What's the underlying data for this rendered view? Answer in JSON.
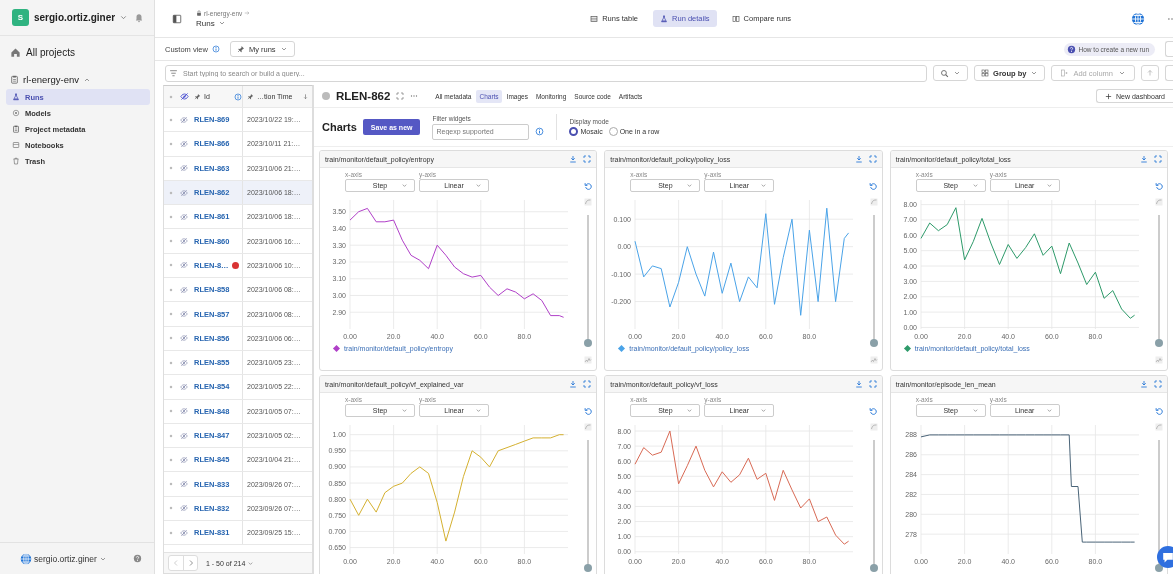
{
  "sidebar": {
    "user": {
      "initial": "S",
      "name": "sergio.ortiz.giner"
    },
    "all_projects": "All projects",
    "project": "rl-energy-env",
    "items": [
      {
        "kind": "runs",
        "label": "Runs",
        "selected": true
      },
      {
        "kind": "models",
        "label": "Models",
        "selected": false
      },
      {
        "kind": "metadata",
        "label": "Project metadata",
        "selected": false
      },
      {
        "kind": "notebooks",
        "label": "Notebooks",
        "selected": false
      },
      {
        "kind": "trash",
        "label": "Trash",
        "selected": false
      }
    ],
    "footer_user": "sergio.ortiz.giner"
  },
  "header": {
    "breadcrumb": "rl-energy-env",
    "page": "Runs",
    "tabs": [
      {
        "kind": "table",
        "label": "Runs table",
        "selected": false
      },
      {
        "kind": "details",
        "label": "Run details",
        "selected": true
      },
      {
        "kind": "compare",
        "label": "Compare runs",
        "selected": false
      }
    ]
  },
  "view_bar": {
    "label": "Custom view",
    "view": "My runs",
    "help_link": "How to create a new run"
  },
  "query_bar": {
    "placeholder": "Start typing to search or build a query...",
    "group_by": "Group by",
    "add_column": {
      "label": "Add column",
      "disabled": true
    }
  },
  "runs_table": {
    "columns": [
      "Id",
      "…tion Time"
    ],
    "rows": [
      {
        "id": "RLEN-869",
        "time": "2023/10/22 19:…",
        "selected": false,
        "failed": false
      },
      {
        "id": "RLEN-866",
        "time": "2023/10/11 21:…",
        "selected": false,
        "failed": false
      },
      {
        "id": "RLEN-863",
        "time": "2023/10/06 21:…",
        "selected": false,
        "failed": false
      },
      {
        "id": "RLEN-862",
        "time": "2023/10/06 18:…",
        "selected": true,
        "failed": false
      },
      {
        "id": "RLEN-861",
        "time": "2023/10/06 18:…",
        "selected": false,
        "failed": false
      },
      {
        "id": "RLEN-860",
        "time": "2023/10/06 16:…",
        "selected": false,
        "failed": false
      },
      {
        "id": "RLEN-8…",
        "time": "2023/10/06 10:…",
        "selected": false,
        "failed": true
      },
      {
        "id": "RLEN-858",
        "time": "2023/10/06 08:…",
        "selected": false,
        "failed": false
      },
      {
        "id": "RLEN-857",
        "time": "2023/10/06 08:…",
        "selected": false,
        "failed": false
      },
      {
        "id": "RLEN-856",
        "time": "2023/10/06 06:…",
        "selected": false,
        "failed": false
      },
      {
        "id": "RLEN-855",
        "time": "2023/10/05 23:…",
        "selected": false,
        "failed": false
      },
      {
        "id": "RLEN-854",
        "time": "2023/10/05 22:…",
        "selected": false,
        "failed": false
      },
      {
        "id": "RLEN-848",
        "time": "2023/10/05 07:…",
        "selected": false,
        "failed": false
      },
      {
        "id": "RLEN-847",
        "time": "2023/10/05 02:…",
        "selected": false,
        "failed": false
      },
      {
        "id": "RLEN-845",
        "time": "2023/10/04 21:…",
        "selected": false,
        "failed": false
      },
      {
        "id": "RLEN-833",
        "time": "2023/09/26 07:…",
        "selected": false,
        "failed": false
      },
      {
        "id": "RLEN-832",
        "time": "2023/09/26 07:…",
        "selected": false,
        "failed": false
      },
      {
        "id": "RLEN-831",
        "time": "2023/09/25 15:…",
        "selected": false,
        "failed": false
      }
    ],
    "pagination": "1 - 50 of 214"
  },
  "run": {
    "id": "RLEN-862",
    "tabs": [
      {
        "label": "All metadata",
        "selected": false
      },
      {
        "label": "Charts",
        "selected": true
      },
      {
        "label": "Images",
        "selected": false
      },
      {
        "label": "Monitoring",
        "selected": false
      },
      {
        "label": "Source code",
        "selected": false
      },
      {
        "label": "Artifacts",
        "selected": false
      }
    ],
    "new_dashboard": "New dashboard"
  },
  "charts_toolbar": {
    "title": "Charts",
    "save": "Save as new",
    "filter_label": "Filter widgets",
    "filter_placeholder": "Regexp supported",
    "display_label": "Display mode",
    "modes": [
      {
        "label": "Mosaic",
        "selected": true
      },
      {
        "label": "One in a row",
        "selected": false
      }
    ]
  },
  "charts": [
    {
      "x_axis": {
        "label": "x-axis",
        "value": "Step"
      },
      "y_axis": {
        "label": "y-axis",
        "value": "Linear"
      },
      "smoothing": {
        "level": 0
      },
      "chart_data": {
        "type": "line",
        "grid": true,
        "title": "train/monitor/default_policy/entropy",
        "x": [
          0,
          4,
          8,
          12,
          16,
          20,
          24,
          28,
          32,
          36,
          40,
          44,
          48,
          52,
          56,
          60,
          64,
          68,
          72,
          76,
          80,
          84,
          88,
          92,
          96,
          98
        ],
        "series": [
          {
            "name": "train/monitor/default_policy/entropy",
            "color": "#b040c8",
            "values": [
              3.45,
              3.5,
              3.52,
              3.44,
              3.44,
              3.45,
              3.33,
              3.24,
              3.21,
              3.16,
              3.3,
              3.24,
              3.17,
              3.13,
              3.11,
              3.12,
              3.05,
              3.0,
              3.04,
              3.02,
              2.98,
              3.01,
              2.97,
              2.88,
              2.88,
              2.87
            ]
          }
        ],
        "xlim": [
          0,
          100
        ],
        "ylim": [
          2.8,
          3.57
        ],
        "xticks": [
          {
            "value": 0,
            "label": "0.00"
          },
          {
            "value": 20,
            "label": "20.0"
          },
          {
            "value": 40,
            "label": "40.0"
          },
          {
            "value": 60,
            "label": "60.0"
          },
          {
            "value": 80,
            "label": "80.0"
          }
        ],
        "yticks": [
          {
            "value": 2.9,
            "label": "2.90"
          },
          {
            "value": 3.0,
            "label": "3.00"
          },
          {
            "value": 3.1,
            "label": "3.10"
          },
          {
            "value": 3.2,
            "label": "3.20"
          },
          {
            "value": 3.3,
            "label": "3.30"
          },
          {
            "value": 3.4,
            "label": "3.40"
          },
          {
            "value": 3.5,
            "label": "3.50"
          }
        ]
      }
    },
    {
      "x_axis": {
        "label": "x-axis",
        "value": "Step"
      },
      "y_axis": {
        "label": "y-axis",
        "value": "Linear"
      },
      "smoothing": {
        "level": 0
      },
      "chart_data": {
        "type": "line",
        "grid": true,
        "title": "train/monitor/default_policy/policy_loss",
        "x": [
          0,
          4,
          8,
          12,
          16,
          20,
          24,
          28,
          32,
          36,
          40,
          44,
          48,
          52,
          56,
          60,
          64,
          68,
          72,
          76,
          80,
          84,
          88,
          92,
          96,
          98
        ],
        "series": [
          {
            "name": "train/monitor/default_policy/policy_loss",
            "color": "#4aa3e8",
            "values": [
              0.02,
              -0.11,
              -0.07,
              -0.08,
              -0.22,
              -0.13,
              0.0,
              -0.1,
              -0.18,
              -0.02,
              -0.17,
              -0.06,
              -0.2,
              -0.11,
              -0.15,
              0.12,
              -0.21,
              -0.04,
              0.1,
              -0.25,
              0.06,
              -0.2,
              0.14,
              -0.2,
              0.03,
              0.05
            ]
          }
        ],
        "xlim": [
          0,
          100
        ],
        "ylim": [
          -0.3,
          0.17
        ],
        "xticks": [
          {
            "value": 0,
            "label": "0.00"
          },
          {
            "value": 20,
            "label": "20.0"
          },
          {
            "value": 40,
            "label": "40.0"
          },
          {
            "value": 60,
            "label": "60.0"
          },
          {
            "value": 80,
            "label": "80.0"
          }
        ],
        "yticks": [
          {
            "value": -0.2,
            "label": "-0.200"
          },
          {
            "value": -0.1,
            "label": "-0.100"
          },
          {
            "value": 0,
            "label": "0.00"
          },
          {
            "value": 0.1,
            "label": "0.100"
          }
        ]
      }
    },
    {
      "x_axis": {
        "label": "x-axis",
        "value": "Step"
      },
      "y_axis": {
        "label": "y-axis",
        "value": "Linear"
      },
      "smoothing": {
        "level": 0
      },
      "chart_data": {
        "type": "line",
        "grid": true,
        "title": "train/monitor/default_policy/total_loss",
        "x": [
          0,
          4,
          8,
          12,
          16,
          20,
          24,
          28,
          32,
          36,
          40,
          44,
          48,
          52,
          56,
          60,
          64,
          68,
          72,
          76,
          80,
          84,
          88,
          92,
          96,
          98
        ],
        "series": [
          {
            "name": "train/monitor/default_policy/total_loss",
            "color": "#2e9a6a",
            "values": [
              5.8,
              6.8,
              6.3,
              6.7,
              7.8,
              4.4,
              5.6,
              7.1,
              5.5,
              4.1,
              5.4,
              4.5,
              5.2,
              6.1,
              4.7,
              5.3,
              3.5,
              5.5,
              4.2,
              2.8,
              3.6,
              1.9,
              2.4,
              1.2,
              0.6,
              0.8
            ]
          }
        ],
        "xlim": [
          0,
          100
        ],
        "ylim": [
          -0.1,
          8.3
        ],
        "xticks": [
          {
            "value": 0,
            "label": "0.00"
          },
          {
            "value": 20,
            "label": "20.0"
          },
          {
            "value": 40,
            "label": "40.0"
          },
          {
            "value": 60,
            "label": "60.0"
          },
          {
            "value": 80,
            "label": "80.0"
          }
        ],
        "yticks": [
          {
            "value": 0,
            "label": "0.00"
          },
          {
            "value": 1,
            "label": "1.00"
          },
          {
            "value": 2,
            "label": "2.00"
          },
          {
            "value": 3,
            "label": "3.00"
          },
          {
            "value": 4,
            "label": "4.00"
          },
          {
            "value": 5,
            "label": "5.00"
          },
          {
            "value": 6,
            "label": "6.00"
          },
          {
            "value": 7,
            "label": "7.00"
          },
          {
            "value": 8,
            "label": "8.00"
          }
        ]
      }
    },
    {
      "x_axis": {
        "label": "x-axis",
        "value": "Step"
      },
      "y_axis": {
        "label": "y-axis",
        "value": "Linear"
      },
      "smoothing": {
        "level": 0
      },
      "chart_data": {
        "type": "line",
        "grid": true,
        "title": "train/monitor/default_policy/vf_explained_var",
        "x": [
          0,
          4,
          8,
          12,
          16,
          20,
          24,
          28,
          32,
          36,
          40,
          44,
          48,
          52,
          56,
          60,
          64,
          68,
          72,
          76,
          80,
          84,
          88,
          92,
          96,
          98
        ],
        "series": [
          {
            "color": "#d4b030",
            "values": [
              0.8,
              0.75,
              0.8,
              0.76,
              0.82,
              0.84,
              0.85,
              0.88,
              0.9,
              0.88,
              0.79,
              0.67,
              0.76,
              0.87,
              0.95,
              0.93,
              0.9,
              0.95,
              0.96,
              0.97,
              0.98,
              0.99,
              0.99,
              0.99,
              1.0,
              1.0
            ]
          }
        ],
        "xlim": [
          0,
          100
        ],
        "ylim": [
          0.63,
          1.03
        ],
        "xticks": [
          {
            "value": 0,
            "label": "0.00"
          },
          {
            "value": 20,
            "label": "20.0"
          },
          {
            "value": 40,
            "label": "40.0"
          },
          {
            "value": 60,
            "label": "60.0"
          },
          {
            "value": 80,
            "label": "80.0"
          }
        ],
        "yticks": [
          {
            "value": 0.65,
            "label": "0.650"
          },
          {
            "value": 0.7,
            "label": "0.700"
          },
          {
            "value": 0.75,
            "label": "0.750"
          },
          {
            "value": 0.8,
            "label": "0.800"
          },
          {
            "value": 0.85,
            "label": "0.850"
          },
          {
            "value": 0.9,
            "label": "0.900"
          },
          {
            "value": 0.95,
            "label": "0.950"
          },
          {
            "value": 1.0,
            "label": "1.00"
          }
        ]
      }
    },
    {
      "x_axis": {
        "label": "x-axis",
        "value": "Step"
      },
      "y_axis": {
        "label": "y-axis",
        "value": "Linear"
      },
      "smoothing": {
        "level": 0
      },
      "chart_data": {
        "type": "line",
        "grid": true,
        "title": "train/monitor/default_policy/vf_loss",
        "x": [
          0,
          4,
          8,
          12,
          16,
          20,
          24,
          28,
          32,
          36,
          40,
          44,
          48,
          52,
          56,
          60,
          64,
          68,
          72,
          76,
          80,
          84,
          88,
          92,
          96,
          98
        ],
        "series": [
          {
            "color": "#d86a55",
            "values": [
              5.8,
              6.9,
              6.4,
              6.6,
              8.0,
              4.5,
              5.7,
              7.0,
              5.4,
              4.3,
              5.3,
              4.6,
              5.1,
              6.2,
              4.8,
              5.2,
              3.4,
              5.4,
              4.1,
              2.9,
              3.5,
              2.0,
              2.3,
              1.1,
              0.5,
              0.7
            ]
          }
        ],
        "xlim": [
          0,
          100
        ],
        "ylim": [
          -0.15,
          8.4
        ],
        "xticks": [
          {
            "value": 0,
            "label": "0.00"
          },
          {
            "value": 20,
            "label": "20.0"
          },
          {
            "value": 40,
            "label": "40.0"
          },
          {
            "value": 60,
            "label": "60.0"
          },
          {
            "value": 80,
            "label": "80.0"
          }
        ],
        "yticks": [
          {
            "value": 0,
            "label": "0.00"
          },
          {
            "value": 1,
            "label": "1.00"
          },
          {
            "value": 2,
            "label": "2.00"
          },
          {
            "value": 3,
            "label": "3.00"
          },
          {
            "value": 4,
            "label": "4.00"
          },
          {
            "value": 5,
            "label": "5.00"
          },
          {
            "value": 6,
            "label": "6.00"
          },
          {
            "value": 7,
            "label": "7.00"
          },
          {
            "value": 8,
            "label": "8.00"
          }
        ]
      }
    },
    {
      "x_axis": {
        "label": "x-axis",
        "value": "Step"
      },
      "y_axis": {
        "label": "y-axis",
        "value": "Linear"
      },
      "smoothing": {
        "level": 0
      },
      "chart_data": {
        "type": "line",
        "grid": true,
        "title": "train/monitor/episode_len_mean",
        "x": [
          0,
          4,
          8,
          12,
          16,
          20,
          24,
          28,
          32,
          36,
          40,
          44,
          48,
          52,
          56,
          60,
          64,
          68,
          69,
          72,
          74,
          76,
          80,
          84,
          88,
          92,
          96,
          98
        ],
        "series": [
          {
            "color": "#4a6478",
            "values": [
              287.8,
              288,
              288,
              288,
              288,
              288,
              288,
              288,
              288,
              288,
              288,
              288,
              288,
              288,
              288,
              288,
              288,
              288,
              282.8,
              282.8,
              277.2,
              277.2,
              277.2,
              277.2,
              277.2,
              277.2,
              277.2,
              277.2
            ]
          }
        ],
        "xlim": [
          0,
          100
        ],
        "ylim": [
          276,
          289
        ],
        "xticks": [
          {
            "value": 0,
            "label": "0.00"
          },
          {
            "value": 20,
            "label": "20.0"
          },
          {
            "value": 40,
            "label": "40.0"
          },
          {
            "value": 60,
            "label": "60.0"
          },
          {
            "value": 80,
            "label": "80.0"
          }
        ],
        "yticks": [
          {
            "value": 278,
            "label": "278"
          },
          {
            "value": 280,
            "label": "280"
          },
          {
            "value": 282,
            "label": "282"
          },
          {
            "value": 284,
            "label": "284"
          },
          {
            "value": 286,
            "label": "286"
          },
          {
            "value": 288,
            "label": "288"
          }
        ]
      }
    }
  ]
}
